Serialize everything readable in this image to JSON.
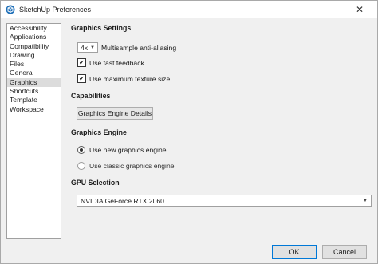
{
  "window": {
    "title": "SketchUp Preferences",
    "close_glyph": "✕"
  },
  "sidebar": {
    "items": [
      {
        "label": "Accessibility"
      },
      {
        "label": "Applications"
      },
      {
        "label": "Compatibility"
      },
      {
        "label": "Drawing"
      },
      {
        "label": "Files"
      },
      {
        "label": "General"
      },
      {
        "label": "Graphics",
        "selected": true
      },
      {
        "label": "Shortcuts"
      },
      {
        "label": "Template"
      },
      {
        "label": "Workspace"
      }
    ]
  },
  "graphics_settings": {
    "header": "Graphics Settings",
    "multisample_value": "4x",
    "multisample_label": "Multisample anti-aliasing",
    "fast_feedback": {
      "label": "Use fast feedback",
      "checked": true
    },
    "max_texture": {
      "label": "Use maximum texture size",
      "checked": true
    }
  },
  "capabilities": {
    "header": "Capabilities",
    "details_button": "Graphics Engine Details"
  },
  "graphics_engine": {
    "header": "Graphics Engine",
    "new_engine": {
      "label": "Use new graphics engine",
      "selected": true
    },
    "classic_engine": {
      "label": "Use classic graphics engine",
      "selected": false
    }
  },
  "gpu_selection": {
    "header": "GPU Selection",
    "selected_gpu": "NVIDIA GeForce RTX 2060"
  },
  "footer": {
    "ok_label": "OK",
    "cancel_label": "Cancel"
  },
  "icons": {
    "app": "sketchup-logo-icon",
    "check": "checkmark-icon",
    "caret": "chevron-down-icon"
  }
}
